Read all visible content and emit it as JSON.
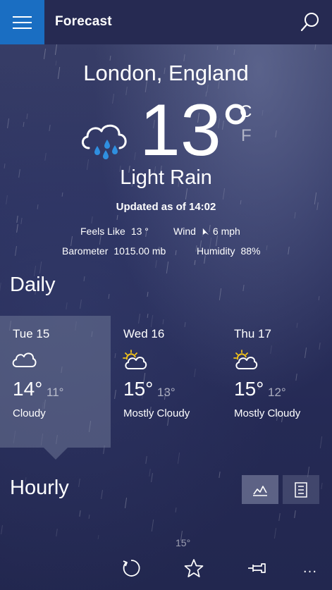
{
  "header": {
    "title": "Forecast"
  },
  "current": {
    "location": "London, England",
    "temperature": "13°",
    "unit_c": "C",
    "unit_f": "F",
    "condition": "Light Rain",
    "updated": "Updated as of 14:02",
    "feels_like_label": "Feels Like",
    "feels_like_value": "13 °",
    "wind_label": "Wind",
    "wind_value": "6 mph",
    "barometer_label": "Barometer",
    "barometer_value": "1015.00 mb",
    "humidity_label": "Humidity",
    "humidity_value": "88%",
    "icon": "rain-cloud-icon"
  },
  "daily": {
    "title": "Daily",
    "days": [
      {
        "name": "Tue 15",
        "hi": "14°",
        "lo": "11°",
        "condition": "Cloudy",
        "icon": "cloud-icon"
      },
      {
        "name": "Wed 16",
        "hi": "15°",
        "lo": "13°",
        "condition": "Mostly Cloudy",
        "icon": "partly-sunny-icon"
      },
      {
        "name": "Thu 17",
        "hi": "15°",
        "lo": "12°",
        "condition": "Mostly Cloudy",
        "icon": "partly-sunny-icon"
      }
    ]
  },
  "hourly": {
    "title": "Hourly",
    "peek_temp": "15°"
  },
  "appbar": {
    "buttons": [
      "refresh-icon",
      "favorite-star-icon",
      "pin-icon",
      "more-options-icon"
    ],
    "more_label": "..."
  },
  "colors": {
    "accent": "#1a6ec2",
    "rain_drop": "#2f8fe0",
    "sun": "#f2c31a"
  }
}
